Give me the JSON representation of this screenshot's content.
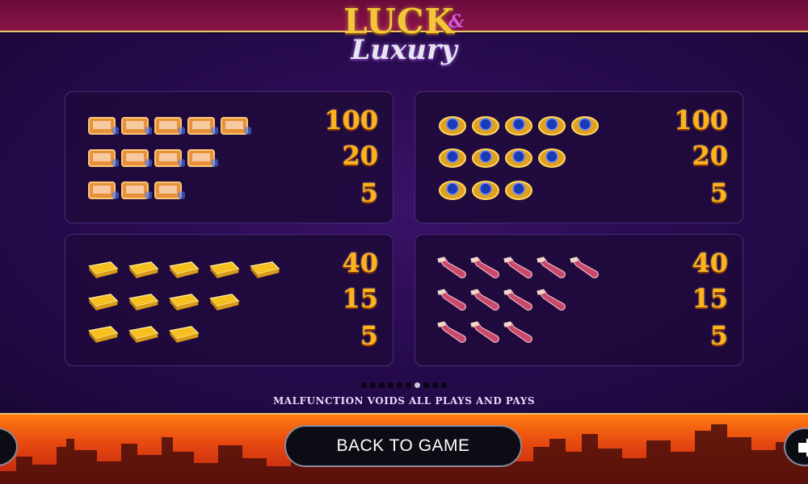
{
  "logo": {
    "word1": "LUCK",
    "ampersand": "&",
    "word2": "Luxury"
  },
  "panels": [
    {
      "symbol": "briefcase-of-cash-icon",
      "payouts": [
        "100",
        "20",
        "5"
      ]
    },
    {
      "symbol": "sapphire-ring-icon",
      "payouts": [
        "100",
        "20",
        "5"
      ]
    },
    {
      "symbol": "gold-bars-icon",
      "payouts": [
        "40",
        "15",
        "5"
      ]
    },
    {
      "symbol": "champagne-bottle-icon",
      "payouts": [
        "40",
        "15",
        "5"
      ]
    }
  ],
  "pagination": {
    "total": 10,
    "active_index": 6
  },
  "disclaimer": "MALFUNCTION VOIDS ALL PLAYS AND PAYS",
  "back_button": "BACK TO GAME",
  "colors": {
    "payout": "#ffb21a",
    "top_band": "#8a1448",
    "accent_gold": "#e8c86a"
  }
}
